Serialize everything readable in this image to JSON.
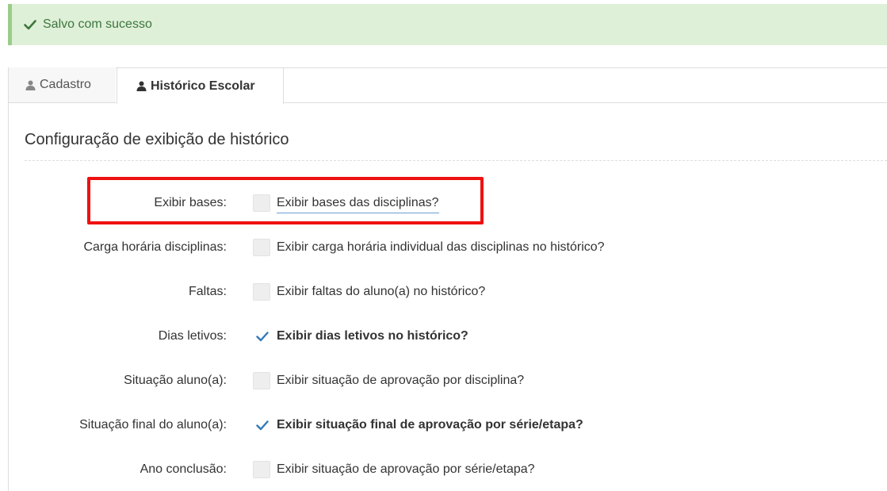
{
  "alert": {
    "message": "Salvo com sucesso",
    "icon": "check-icon",
    "color": "#3c763d",
    "background": "#dff0d8"
  },
  "tabs": [
    {
      "label": "Cadastro",
      "icon": "user-icon",
      "active": false
    },
    {
      "label": "Histórico Escolar",
      "icon": "user-icon",
      "active": true
    }
  ],
  "section": {
    "title": "Configuração de exibição de histórico"
  },
  "options": [
    {
      "label": "Exibir bases:",
      "text": "Exibir bases das disciplinas?",
      "checked": false
    },
    {
      "label": "Carga horária disciplinas:",
      "text": "Exibir carga horária individual das disciplinas no histórico?",
      "checked": false
    },
    {
      "label": "Faltas:",
      "text": "Exibir faltas do aluno(a) no histórico?",
      "checked": false
    },
    {
      "label": "Dias letivos:",
      "text": "Exibir dias letivos no histórico?",
      "checked": true
    },
    {
      "label": "Situação aluno(a):",
      "text": "Exibir situação de aprovação por disciplina?",
      "checked": false
    },
    {
      "label": "Situação final do aluno(a):",
      "text": "Exibir situação final de aprovação por série/etapa?",
      "checked": true
    },
    {
      "label": "Ano conclusão:",
      "text": "Exibir situação de aprovação por série/etapa?",
      "checked": false
    }
  ],
  "colors": {
    "highlight": "#ee1111",
    "checkmark": "#337ab7"
  }
}
